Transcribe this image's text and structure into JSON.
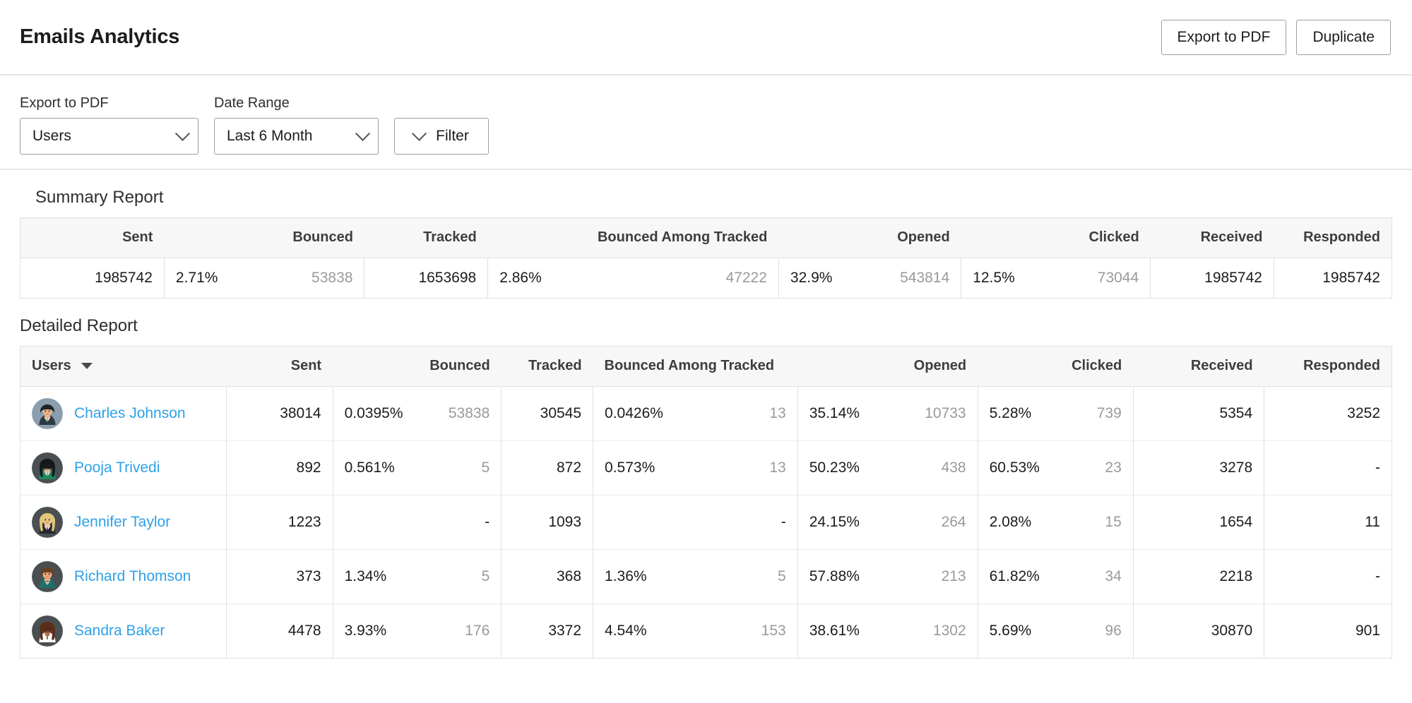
{
  "header": {
    "title": "Emails Analytics",
    "export_label": "Export to PDF",
    "duplicate_label": "Duplicate"
  },
  "filters": {
    "export_label": "Export to PDF",
    "export_value": "Users",
    "date_label": "Date Range",
    "date_value": "Last 6 Month",
    "filter_label": "Filter"
  },
  "summary": {
    "title": "Summary Report",
    "columns": [
      "Sent",
      "Bounced",
      "Tracked",
      "Bounced Among Tracked",
      "Opened",
      "Clicked",
      "Received",
      "Responded"
    ],
    "row": {
      "sent": "1985742",
      "bounced_pct": "2.71%",
      "bounced_cnt": "53838",
      "tracked": "1653698",
      "bat_pct": "2.86%",
      "bat_cnt": "47222",
      "opened_pct": "32.9%",
      "opened_cnt": "543814",
      "clicked_pct": "12.5%",
      "clicked_cnt": "73044",
      "received": "1985742",
      "responded": "1985742"
    }
  },
  "detailed": {
    "title": "Detailed Report",
    "columns": {
      "users": "Users",
      "sent": "Sent",
      "bounced": "Bounced",
      "tracked": "Tracked",
      "bounced_among_tracked": "Bounced Among Tracked",
      "opened": "Opened",
      "clicked": "Clicked",
      "received": "Received",
      "responded": "Responded"
    },
    "rows": [
      {
        "name": "Charles Johnson",
        "sent": "38014",
        "bounced_pct": "0.0395%",
        "bounced_cnt": "53838",
        "tracked": "30545",
        "bat_pct": "0.0426%",
        "bat_cnt": "13",
        "opened_pct": "35.14%",
        "opened_cnt": "10733",
        "clicked_pct": "5.28%",
        "clicked_cnt": "739",
        "received": "5354",
        "responded": "3252"
      },
      {
        "name": "Pooja Trivedi",
        "sent": "892",
        "bounced_pct": "0.561%",
        "bounced_cnt": "5",
        "tracked": "872",
        "bat_pct": "0.573%",
        "bat_cnt": "13",
        "opened_pct": "50.23%",
        "opened_cnt": "438",
        "clicked_pct": "60.53%",
        "clicked_cnt": "23",
        "received": "3278",
        "responded": "-"
      },
      {
        "name": "Jennifer Taylor",
        "sent": "1223",
        "bounced_pct": "",
        "bounced_cnt": "-",
        "tracked": "1093",
        "bat_pct": "",
        "bat_cnt": "-",
        "opened_pct": "24.15%",
        "opened_cnt": "264",
        "clicked_pct": "2.08%",
        "clicked_cnt": "15",
        "received": "1654",
        "responded": "11"
      },
      {
        "name": "Richard Thomson",
        "sent": "373",
        "bounced_pct": "1.34%",
        "bounced_cnt": "5",
        "tracked": "368",
        "bat_pct": "1.36%",
        "bat_cnt": "5",
        "opened_pct": "57.88%",
        "opened_cnt": "213",
        "clicked_pct": "61.82%",
        "clicked_cnt": "34",
        "received": "2218",
        "responded": "-"
      },
      {
        "name": "Sandra Baker",
        "sent": "4478",
        "bounced_pct": "3.93%",
        "bounced_cnt": "176",
        "tracked": "3372",
        "bat_pct": "4.54%",
        "bat_cnt": "153",
        "opened_pct": "38.61%",
        "opened_cnt": "1302",
        "clicked_pct": "5.69%",
        "clicked_cnt": "96",
        "received": "30870",
        "responded": "901"
      }
    ]
  },
  "colors": {
    "link": "#2ea1e8",
    "muted": "#9a9a9a",
    "header_bg": "#f7f7f7",
    "border": "#e0e0e0"
  }
}
